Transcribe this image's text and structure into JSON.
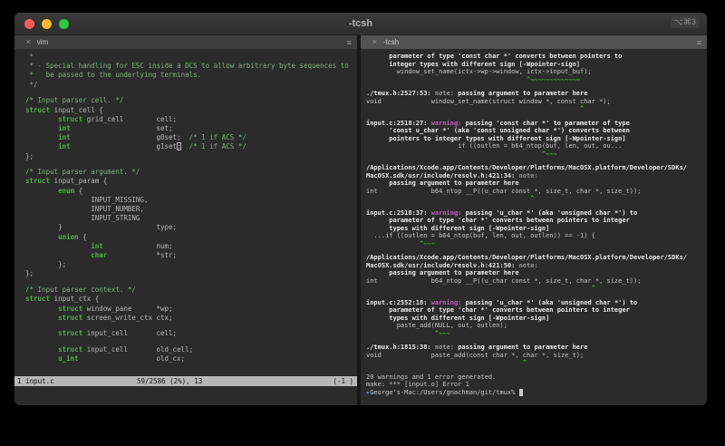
{
  "window": {
    "title": "-tcsh",
    "shortcut": "⌥⌘3"
  },
  "icons": {
    "close": "✕",
    "menu": "≡"
  },
  "left_pane": {
    "tab_label": "vim",
    "status": {
      "left": "1 input.c",
      "center": "59/2586 (2%), 13",
      "right": "(-1 )"
    },
    "lines": [
      [
        [
          "c",
          " *"
        ]
      ],
      [
        [
          "c",
          " * - Special handling for ESC inside a DCS to allow arbitrary byte sequences to"
        ]
      ],
      [
        [
          "c",
          " *   be passed to the underlying terminals."
        ]
      ],
      [
        [
          "c",
          " */"
        ]
      ],
      [],
      [
        [
          "c",
          "/* Input parser cell. */"
        ]
      ],
      [
        [
          "k",
          "struct"
        ],
        [
          "p",
          " input_cell {"
        ]
      ],
      [
        [
          "p",
          "        "
        ],
        [
          "k",
          "struct"
        ],
        [
          "p",
          " grid_cell        cell;"
        ]
      ],
      [
        [
          "p",
          "        "
        ],
        [
          "k",
          "int"
        ],
        [
          "p",
          "                     set;"
        ]
      ],
      [
        [
          "p",
          "        "
        ],
        [
          "k",
          "int"
        ],
        [
          "p",
          "                     g0set;"
        ],
        [
          "c",
          "  /* 1 if ACS */"
        ]
      ],
      [
        [
          "p",
          "        "
        ],
        [
          "k",
          "int"
        ],
        [
          "p",
          "                     g1set"
        ],
        [
          "curh",
          ";"
        ],
        [
          "c",
          "  /* 1 if ACS */"
        ]
      ],
      [
        [
          "p",
          "};"
        ]
      ],
      [],
      [
        [
          "c",
          "/* Input parser argument. */"
        ]
      ],
      [
        [
          "k",
          "struct"
        ],
        [
          "p",
          " input_param {"
        ]
      ],
      [
        [
          "p",
          "        "
        ],
        [
          "k",
          "enum"
        ],
        [
          "p",
          " {"
        ]
      ],
      [
        [
          "p",
          "                INPUT_MISSING,"
        ]
      ],
      [
        [
          "p",
          "                INPUT_NUMBER,"
        ]
      ],
      [
        [
          "p",
          "                INPUT_STRING"
        ]
      ],
      [
        [
          "p",
          "        }                       type;"
        ]
      ],
      [
        [
          "p",
          "        "
        ],
        [
          "k",
          "union"
        ],
        [
          "p",
          " {"
        ]
      ],
      [
        [
          "p",
          "                "
        ],
        [
          "k",
          "int"
        ],
        [
          "p",
          "             num;"
        ]
      ],
      [
        [
          "p",
          "                "
        ],
        [
          "k",
          "char"
        ],
        [
          "p",
          "            *str;"
        ]
      ],
      [
        [
          "p",
          "        };"
        ]
      ],
      [
        [
          "p",
          "};"
        ]
      ],
      [],
      [
        [
          "c",
          "/* Input parser context. */"
        ]
      ],
      [
        [
          "k",
          "struct"
        ],
        [
          "p",
          " input_ctx {"
        ]
      ],
      [
        [
          "p",
          "        "
        ],
        [
          "k",
          "struct"
        ],
        [
          "p",
          " window_pane      *wp;"
        ]
      ],
      [
        [
          "p",
          "        "
        ],
        [
          "k",
          "struct"
        ],
        [
          "p",
          " screen_write_ctx ctx;"
        ]
      ],
      [],
      [
        [
          "p",
          "        "
        ],
        [
          "k",
          "struct"
        ],
        [
          "p",
          " input_cell       cell;"
        ]
      ],
      [],
      [
        [
          "p",
          "        "
        ],
        [
          "k",
          "struct"
        ],
        [
          "p",
          " input_cell       old_cell;"
        ]
      ],
      [
        [
          "p",
          "        "
        ],
        [
          "k",
          "u_int"
        ],
        [
          "p",
          "                   old_cx;"
        ]
      ]
    ]
  },
  "right_pane": {
    "tab_label": "-tcsh",
    "lines": [
      [
        [
          "w",
          "      parameter of type 'const char *' converts between pointers to"
        ]
      ],
      [
        [
          "w",
          "      integer types with different sign [-Wpointer-sign]"
        ]
      ],
      [
        [
          "t",
          "        window_set_name(ictx->wp->window, ictx->input_buf);"
        ]
      ],
      [
        [
          "n",
          "                                          ^~~~~~~~~~~~~~"
        ]
      ],
      [],
      [
        [
          "w",
          "./tmux.h:2527:53: "
        ],
        [
          "g",
          "note: "
        ],
        [
          "w",
          "passing argument to parameter here"
        ]
      ],
      [
        [
          "t",
          "void             window_set_name(struct window *, const char *);"
        ]
      ],
      [
        [
          "n",
          "                                                        ^"
        ]
      ],
      [],
      [
        [
          "w",
          "input.c:2518:27: "
        ],
        [
          "m",
          "warning: "
        ],
        [
          "w",
          "passing 'const char *' to parameter of type"
        ]
      ],
      [
        [
          "w",
          "      'const u_char *' (aka 'const unsigned char *') converts between"
        ]
      ],
      [
        [
          "w",
          "      pointers to integer types with different sign [-Wpointer-sign]"
        ]
      ],
      [
        [
          "t",
          "                        if ((outlen = b64_ntop(buf, len, out, ou..."
        ]
      ],
      [
        [
          "n",
          "                                              ^~~~"
        ]
      ],
      [],
      [
        [
          "w",
          "/Applications/Xcode.app/Contents/Developer/Platforms/MacOSX.platform/Developer/SDKs/"
        ]
      ],
      [
        [
          "w",
          "MacOSX.sdk/usr/include/resolv.h:421:34: "
        ],
        [
          "g",
          "note:"
        ]
      ],
      [
        [
          "w",
          "      passing argument to parameter here"
        ]
      ],
      [
        [
          "t",
          "int              b64_ntop __P((u_char const *, size_t, char *, size_t));"
        ]
      ],
      [
        [
          "n",
          "                                           ^"
        ]
      ],
      [],
      [
        [
          "w",
          "input.c:2518:37: "
        ],
        [
          "m",
          "warning: "
        ],
        [
          "w",
          "passing 'u_char *' (aka 'unsigned char *') to"
        ]
      ],
      [
        [
          "w",
          "      parameter of type 'char *' converts between pointers to integer"
        ]
      ],
      [
        [
          "w",
          "      types with different sign [-Wpointer-sign]"
        ]
      ],
      [
        [
          "t",
          "  ...if ((outlen = b64_ntop(buf, len, out, outlen)) == -1) {"
        ]
      ],
      [
        [
          "n",
          "              ^~~~"
        ]
      ],
      [],
      [
        [
          "w",
          "/Applications/Xcode.app/Contents/Developer/Platforms/MacOSX.platform/Developer/SDKs/"
        ]
      ],
      [
        [
          "w",
          "MacOSX.sdk/usr/include/resolv.h:421:50: "
        ],
        [
          "g",
          "note:"
        ]
      ],
      [
        [
          "w",
          "      passing argument to parameter here"
        ]
      ],
      [
        [
          "t",
          "int              b64_ntop __P((u_char const *, size_t, char *, size_t));"
        ]
      ],
      [
        [
          "n",
          "                                                           ^"
        ]
      ],
      [],
      [
        [
          "w",
          "input.c:2552:18: "
        ],
        [
          "m",
          "warning: "
        ],
        [
          "w",
          "passing 'u_char *' (aka 'unsigned char *') to"
        ]
      ],
      [
        [
          "w",
          "      parameter of type 'char *' converts between pointers to integer"
        ]
      ],
      [
        [
          "w",
          "      types with different sign [-Wpointer-sign]"
        ]
      ],
      [
        [
          "t",
          "        paste_add(NULL, out, outlen);"
        ]
      ],
      [
        [
          "n",
          "                  ^~~~"
        ]
      ],
      [],
      [
        [
          "w",
          "./tmux.h:1815:38: "
        ],
        [
          "g",
          "note: "
        ],
        [
          "w",
          "passing argument to parameter here"
        ]
      ],
      [
        [
          "t",
          "void             paste_add(const char *, char *, size_t);"
        ]
      ],
      [
        [
          "n",
          "                                         ^"
        ]
      ],
      [],
      [
        [
          "t",
          "20 warnings and 1 error generated."
        ]
      ],
      [
        [
          "t",
          "make: *** [input.o] Error 1"
        ]
      ],
      [
        [
          "b",
          "▸"
        ],
        [
          "t",
          "George's-Mac:/Users/gnachman/git/tmux% "
        ],
        [
          "curb",
          " "
        ]
      ]
    ]
  }
}
